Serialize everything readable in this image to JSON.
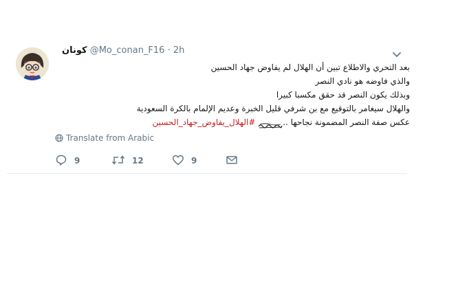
{
  "tweet": {
    "display_name": "كونان",
    "handle": "@Mo_conan_F16",
    "separator": "·",
    "time": "2h",
    "lines": [
      "بعد التحري والاطلاع تبين أن الهلال لم يفاوض جهاد الحسين",
      "والذي فاوضه هو نادي النصر",
      "وبذلك يكون النصر قد حقق مكسبا كبيرا",
      "والهلال سيغامر بالتوقيع مع بن شرفي قليل الخبرة وعديم الإلمام بالكرة السعودية"
    ],
    "last_line_text": "عكس صفة النصر المضمونة نجاحها ..",
    "hashtag": "#الهلال_يفاوض_جهاد_الحسين",
    "translate_label": "Translate from Arabic",
    "replies": "9",
    "retweets": "12",
    "likes": "9",
    "colors": {
      "hashtag": "#cc1f1f",
      "muted": "#657786",
      "text": "#14171a"
    },
    "icons": [
      "chevron-down-icon",
      "globe-icon",
      "reply-icon",
      "retweet-icon",
      "like-icon",
      "message-icon"
    ]
  }
}
